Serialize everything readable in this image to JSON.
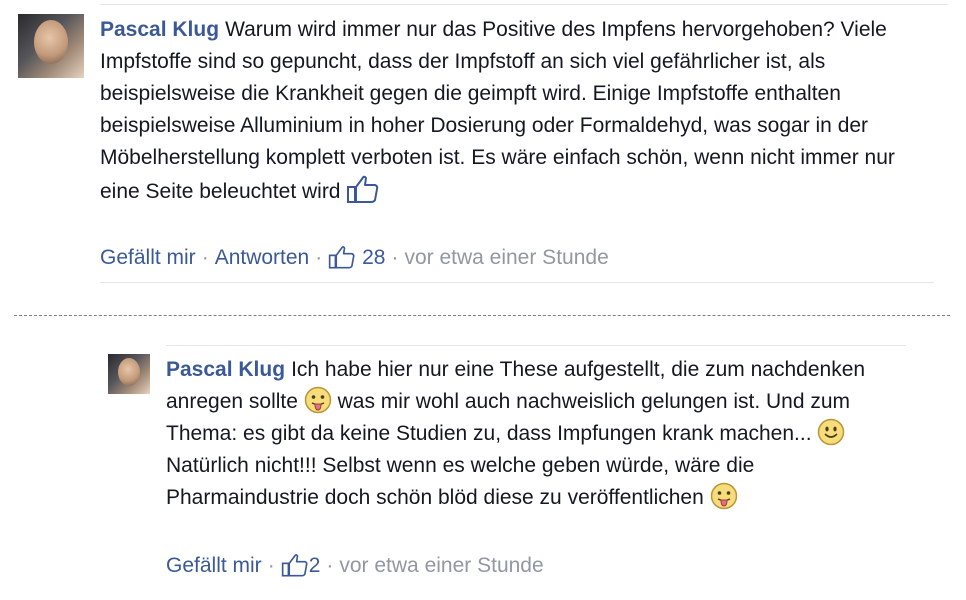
{
  "comments": [
    {
      "author": "Pascal Klug",
      "text": "Warum wird immer nur das Positive des Impfens hervorgehoben? Viele Impfstoffe sind so gepuncht, dass der Impfstoff an sich viel gefährlicher ist, als beispielsweise die Krankheit gegen die geimpft wird. Einige Impfstoffe enthalten beispielsweise Alluminium in hoher Dosierung oder Formaldehyd, was sogar in der Möbelherstellung komplett verboten ist. Es wäre einfach schön, wenn nicht immer nur eine Seite beleuchtet wird",
      "actions": {
        "like": "Gefällt mir",
        "reply": "Antworten"
      },
      "like_count": "28",
      "timestamp": "vor etwa einer Stunde"
    },
    {
      "author": "Pascal Klug",
      "text_1": "Ich habe hier nur eine These aufgestellt, die zum nachdenken anregen sollte",
      "text_2": "was mir wohl auch nachweislich gelungen ist. Und zum Thema: es gibt da keine Studien zu, dass Impfungen krank machen...",
      "text_3": "Natürlich nicht!!! Selbst wenn es welche geben würde, wäre die Pharmaindustrie doch schön blöd diese zu veröffentlichen",
      "actions": {
        "like": "Gefällt mir"
      },
      "like_count": "2",
      "timestamp": "vor etwa einer Stunde"
    }
  ],
  "separator": "·",
  "colors": {
    "link": "#3b5998",
    "meta": "#9197a3",
    "text": "#141823"
  },
  "icons": [
    "thumbs-up-icon",
    "tongue-emoji-icon",
    "smile-emoji-icon"
  ]
}
